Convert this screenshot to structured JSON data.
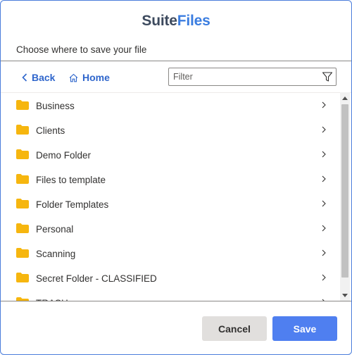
{
  "logo": {
    "part1": "Suite",
    "part2": "Files"
  },
  "header": {
    "subtitle": "Choose where to save your file"
  },
  "nav": {
    "back_label": "Back",
    "home_label": "Home"
  },
  "filter": {
    "placeholder": "Filter",
    "value": ""
  },
  "folders": [
    {
      "name": "Business"
    },
    {
      "name": "Clients"
    },
    {
      "name": "Demo Folder"
    },
    {
      "name": "Files to template"
    },
    {
      "name": "Folder Templates"
    },
    {
      "name": "Personal"
    },
    {
      "name": "Scanning"
    },
    {
      "name": "Secret Folder - CLASSIFIED"
    },
    {
      "name": "TRASH"
    }
  ],
  "footer": {
    "cancel_label": "Cancel",
    "save_label": "Save"
  },
  "colors": {
    "accent": "#4f7ff0",
    "link": "#2f66cc",
    "folder": "#f6b60f",
    "logo_dark": "#3d4a5e",
    "logo_blue": "#3b7de0"
  },
  "icons": {
    "back": "chevron-left-icon",
    "home": "home-icon",
    "filter": "funnel-icon",
    "folder": "folder-icon",
    "row_action": "chevron-right-icon"
  }
}
